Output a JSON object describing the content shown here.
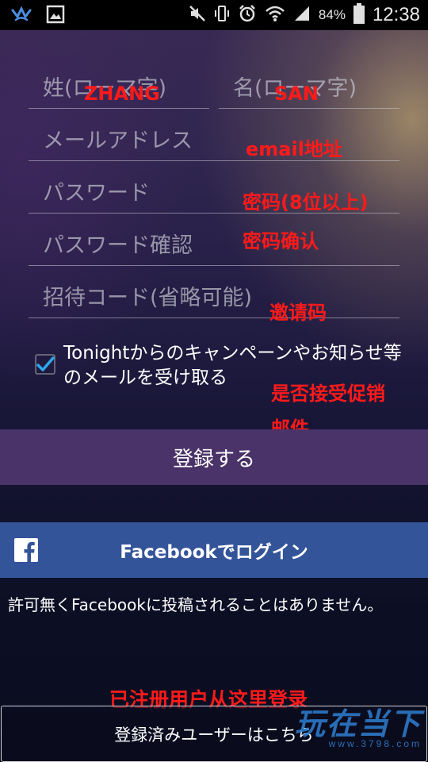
{
  "status_bar": {
    "battery_percent": "84%",
    "time": "12:38",
    "left_icons": [
      "app-notification-icon",
      "gallery-icon"
    ],
    "right_icons": [
      "mute-icon",
      "vibrate-icon",
      "alarm-icon",
      "wifi-icon",
      "signal-icon",
      "battery-icon"
    ]
  },
  "form": {
    "last_name_placeholder": "姓(ローマ字)",
    "first_name_placeholder": "名(ローマ字)",
    "email_placeholder": "メールアドレス",
    "password_placeholder": "パスワード",
    "password_confirm_placeholder": "パスワード確認",
    "invite_code_placeholder": "招待コード(省略可能)",
    "newsletter_label": "Tonightからのキャンペーンやお知らせ等のメールを受け取る",
    "newsletter_checked": true,
    "register_button": "登録する"
  },
  "facebook": {
    "login_label": "Facebookでログイン",
    "disclaimer": "許可無くFacebookに投稿されることはありません。",
    "brand_color": "#34549a"
  },
  "login_existing": {
    "label": "登録済みユーザーはこちら"
  },
  "annotations": {
    "last_name": "ZHANG",
    "first_name": "SAN",
    "email": "email地址",
    "password": "密码(8位以上)",
    "password_confirm": "密码确认",
    "invite_code": "邀请码",
    "newsletter_line1": "是否接受促销",
    "newsletter_line2": "邮件",
    "existing_user": "已注册用户从这里登录",
    "color": "#ff1a1a"
  },
  "watermark": {
    "main": "玩在当下",
    "sub": "www.3798.com"
  }
}
